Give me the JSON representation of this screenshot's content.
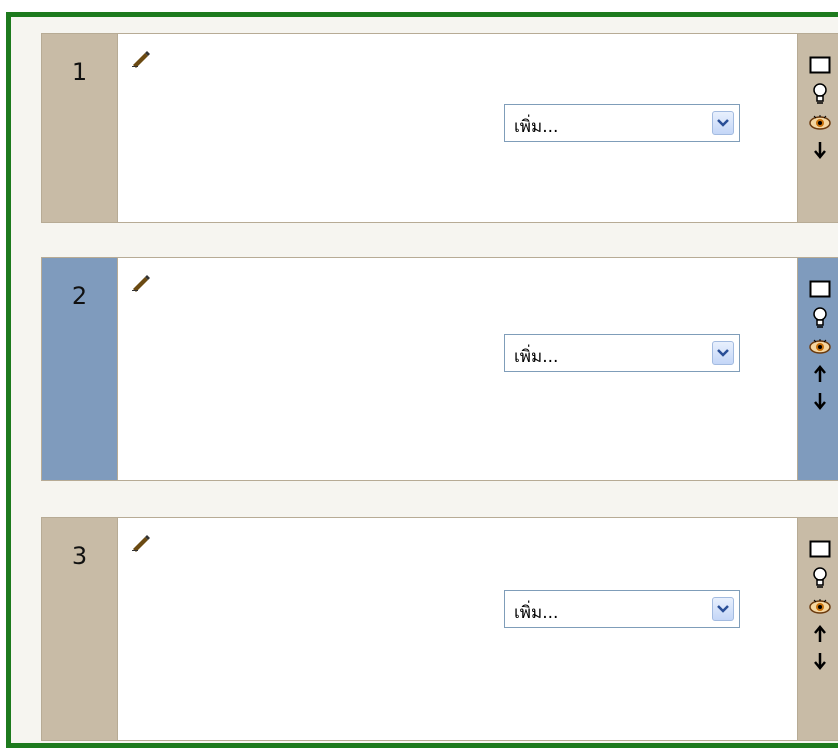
{
  "sections": [
    {
      "number": "1",
      "add_menu": {
        "selected": "เพิ่ม..."
      },
      "controls": [
        "hide-box-icon",
        "lightbulb-icon",
        "eye-icon",
        "move-down-arrow-icon"
      ]
    },
    {
      "number": "2",
      "add_menu": {
        "selected": "เพิ่ม..."
      },
      "controls": [
        "hide-box-icon",
        "lightbulb-icon",
        "eye-icon",
        "move-up-arrow-icon",
        "move-down-arrow-icon"
      ]
    },
    {
      "number": "3",
      "add_menu": {
        "selected": "เพิ่ม..."
      },
      "controls": [
        "hide-box-icon",
        "lightbulb-icon",
        "eye-icon",
        "move-up-arrow-icon",
        "move-down-arrow-icon"
      ]
    }
  ],
  "colors": {
    "frame_border": "#1d7a1d",
    "section_side": "#c8bba6",
    "highlight_side": "#7f9bbd"
  }
}
